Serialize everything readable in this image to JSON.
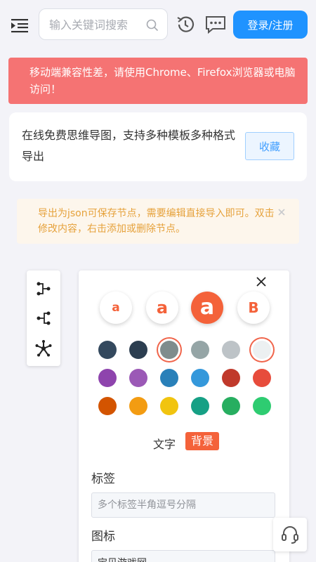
{
  "header": {
    "search_placeholder": "输入关键词搜索",
    "login_label": "登录/注册",
    "icons": [
      "menu-icon",
      "search-icon",
      "history-icon",
      "message-icon"
    ]
  },
  "notice": {
    "warning": "移动端兼容性差，请使用Chrome、Firefox浏览器或电脑访问！"
  },
  "card": {
    "description": "在线免费思维导图，支持多种模板多种格式导出",
    "favorite_label": "收藏"
  },
  "tip": {
    "text": "导出为json可保存节点，需要编辑直接导入即可。双击修改内容，右击添加或删除节点。"
  },
  "toolbar": {
    "icons": [
      "structure-right-icon",
      "structure-left-icon",
      "structure-radial-icon"
    ]
  },
  "style_panel": {
    "style_options": [
      "a",
      "a",
      "a",
      "B"
    ],
    "selected_style_index": 2,
    "swatch_colors": [
      "#34495e",
      "#2c3e50",
      "#7f8c8d",
      "#95a5a6",
      "#bdc3c7",
      "#ecf0f1",
      "#8e44ad",
      "#9b59b6",
      "#2980b9",
      "#3498db",
      "#c0392b",
      "#e74c3c",
      "#d35400",
      "#f39c12",
      "#f1c40f",
      "#16a085",
      "#27ae60",
      "#2ecc71"
    ],
    "selected_swatches": [
      2,
      5
    ],
    "text_mode_label": "文字",
    "bg_mode_label": "背景",
    "tag_label": "标签",
    "tag_placeholder": "多个标签半角逗号分隔",
    "icon_label": "图标",
    "icon_value": "宝贝游戏网"
  },
  "colors": {
    "primary": "#1f93ff",
    "danger": "#f57373",
    "accent": "#f4623a",
    "warning_text": "#e6a23c"
  }
}
